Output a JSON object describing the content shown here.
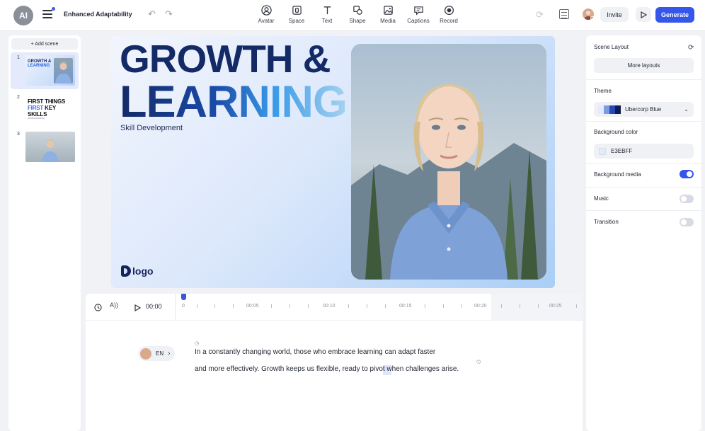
{
  "app": {
    "logo_text": "AI",
    "project_title": "Enhanced Adaptability"
  },
  "toolbar": {
    "items": [
      {
        "label": "Avatar",
        "icon": "avatar-icon"
      },
      {
        "label": "Space",
        "icon": "space-icon"
      },
      {
        "label": "Text",
        "icon": "text-icon"
      },
      {
        "label": "Shape",
        "icon": "shape-icon"
      },
      {
        "label": "Media",
        "icon": "media-icon"
      },
      {
        "label": "Captions",
        "icon": "captions-icon"
      },
      {
        "label": "Record",
        "icon": "record-icon"
      }
    ],
    "invite_label": "Invite",
    "generate_label": "Generate"
  },
  "scenes": {
    "add_label": "+ Add scene",
    "items": [
      {
        "number": "1",
        "title_line1": "GROWTH &",
        "title_line2": "LEARNING",
        "active": true
      },
      {
        "number": "2",
        "title_line1": "FIRST THINGS",
        "title_line2a": "FIRST",
        "title_line2b": "KEY",
        "title_line3": "SKILLS",
        "active": false
      },
      {
        "number": "3",
        "active": false
      }
    ]
  },
  "canvas": {
    "headline_line1": "GROWTH &",
    "headline_line2": "LEARNING",
    "subtitle": "Skill Development",
    "logo_text": "logo"
  },
  "timeline": {
    "voice_label": "A))",
    "time": "00:00",
    "ticks": [
      "0",
      "00:05",
      "00:10",
      "00:15",
      "00:20",
      "00:25"
    ]
  },
  "script": {
    "language": "EN",
    "line1": "In a constantly changing world, those who embrace learning can adapt faster",
    "line2": "and more effectively. Growth keeps us flexible, ready to pivot when challenges arise."
  },
  "properties": {
    "scene_layout_title": "Scene Layout",
    "more_layouts_label": "More layouts",
    "theme_title": "Theme",
    "theme_name": "Ubercorp Blue",
    "theme_swatches": [
      "#e3ebff",
      "#7f9be0",
      "#2a47b8",
      "#0e1c54"
    ],
    "background_color_title": "Background color",
    "background_color_value": "E3EBFF",
    "background_color_hex": "#E3EBFF",
    "background_media_title": "Background media",
    "background_media_on": true,
    "music_title": "Music",
    "music_on": false,
    "transition_title": "Transition",
    "transition_on": false
  },
  "colors": {
    "accent": "#3456EA",
    "headline_dark": "#132A66"
  }
}
